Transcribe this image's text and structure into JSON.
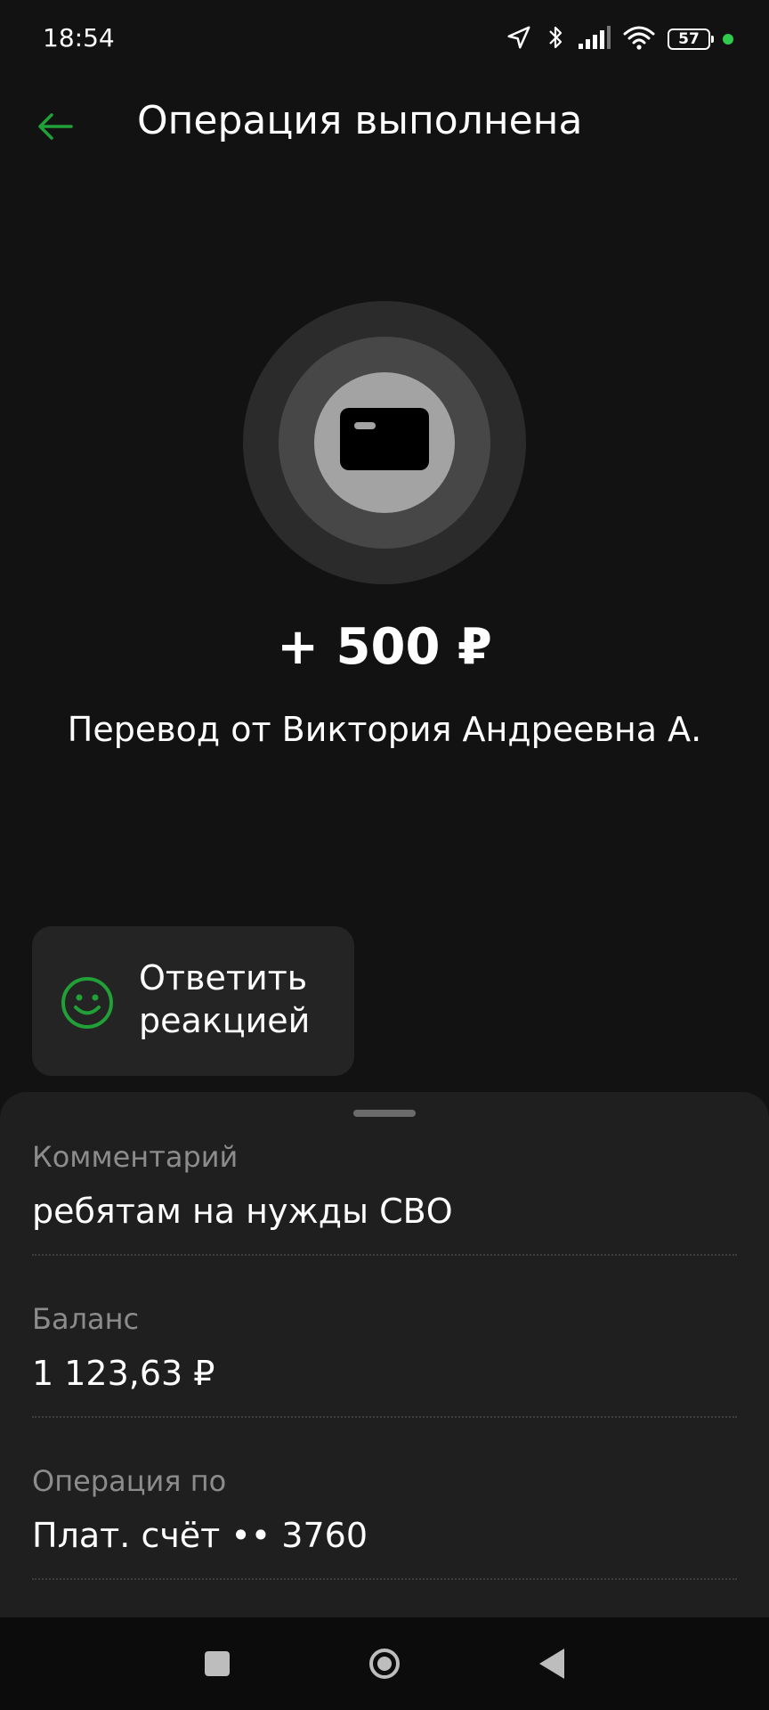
{
  "status_bar": {
    "time": "18:54",
    "battery": "57",
    "icons": [
      "location-icon",
      "bluetooth-icon",
      "signal-icon",
      "wifi-icon",
      "battery-icon",
      "status-dot"
    ]
  },
  "header": {
    "title": "Операция выполнена",
    "back_icon": "arrow-left-icon"
  },
  "hero": {
    "icon": "card-icon",
    "amount": "+ 500 ₽",
    "description": "Перевод от Виктория Андреевна А."
  },
  "reaction": {
    "label": "Ответить реакцией",
    "icon": "smile-icon"
  },
  "details": [
    {
      "label": "Комментарий",
      "value": "ребятам на нужды СВО"
    },
    {
      "label": "Баланс",
      "value": "1 123,63 ₽"
    },
    {
      "label": "Операция по",
      "value": "Плат. счёт •• 3760"
    }
  ],
  "nav": {
    "icons": [
      "recents-icon",
      "home-icon",
      "back-icon"
    ]
  },
  "colors": {
    "background": "#121212",
    "accent_green": "#21a038",
    "sheet": "#1f1f1f",
    "muted_text": "#8c8c8c"
  }
}
